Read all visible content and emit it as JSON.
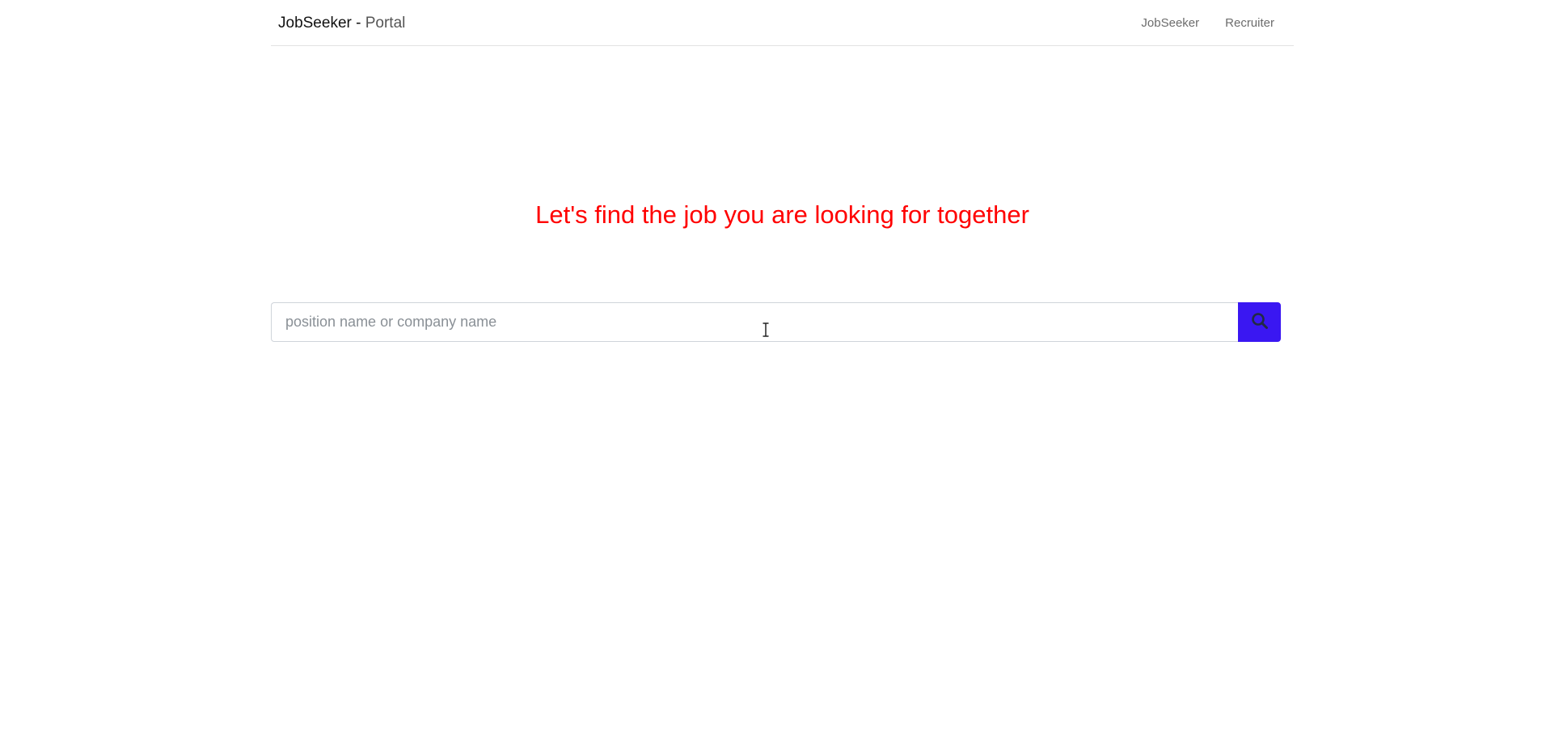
{
  "navbar": {
    "brand_main": "JobSeeker -",
    "brand_sub": "Portal",
    "links": [
      {
        "label": "JobSeeker"
      },
      {
        "label": "Recruiter"
      }
    ]
  },
  "hero": {
    "headline": "Let's find the job you are looking for together"
  },
  "search": {
    "placeholder": "position name or company name",
    "value": "",
    "button_icon": "search-icon"
  },
  "colors": {
    "headline": "#ff0000",
    "search_button": "#3a17f2",
    "nav_link": "#6c6c6c"
  }
}
